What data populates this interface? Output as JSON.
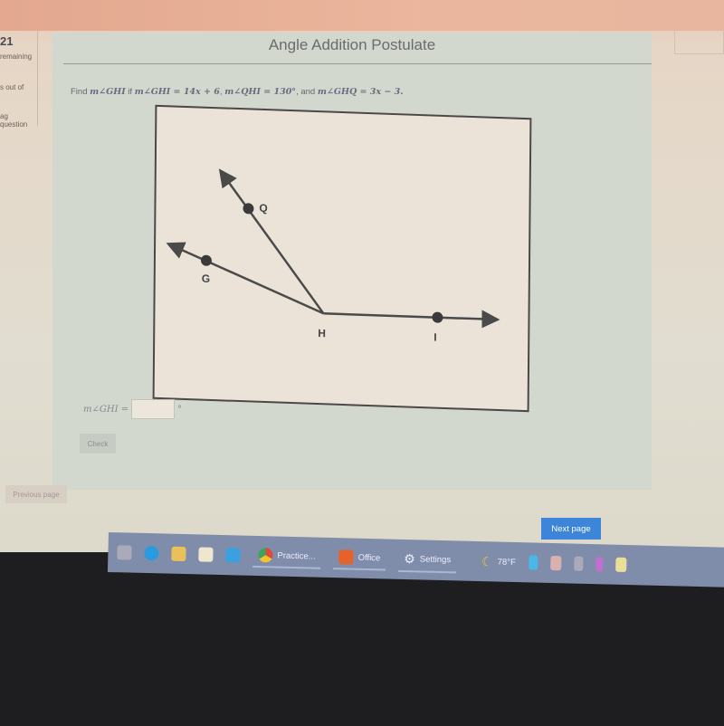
{
  "left_panel": {
    "question_number": "21",
    "remaining": "remaining",
    "score": "s out of",
    "flag": "ag question"
  },
  "main": {
    "title": "Angle Addition Postulate",
    "question_prefix": "Find ",
    "q_target": "m∠GHI",
    "q_if": " if ",
    "q_eq1": "m∠GHI = 14x + 6",
    "q_sep1": ", ",
    "q_eq2": "m∠QHI = 130°",
    "q_and": ", and ",
    "q_eq3": "m∠GHQ = 3x − 3.",
    "diagram": {
      "points": [
        "Q",
        "G",
        "H",
        "I"
      ]
    },
    "answer_label": "m∠GHI =",
    "answer_value": "",
    "answer_unit": "°",
    "check_label": "Check"
  },
  "nav": {
    "previous": "Previous page",
    "next": "Next page"
  },
  "taskbar": {
    "apps": [
      {
        "label": "Practice..."
      },
      {
        "label": "Office"
      },
      {
        "label": "Settings"
      }
    ],
    "weather": "78°F"
  }
}
